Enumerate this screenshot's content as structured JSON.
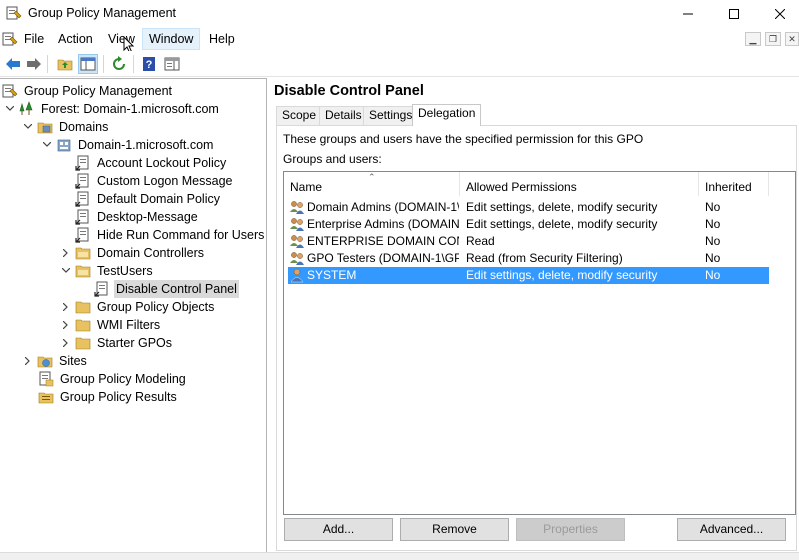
{
  "window": {
    "title": "Group Policy Management"
  },
  "menu": {
    "items": [
      "File",
      "Action",
      "View",
      "Window",
      "Help"
    ]
  },
  "tree": {
    "items": [
      {
        "label": "Group Policy Management",
        "icon": "gpm-icon"
      },
      {
        "label": "Forest: Domain-1.microsoft.com",
        "icon": "forest-icon"
      },
      {
        "label": "Domains",
        "icon": "domains-folder-icon"
      },
      {
        "label": "Domain-1.microsoft.com",
        "icon": "domain-icon"
      },
      {
        "label": "Account Lockout Policy",
        "icon": "gpo-link-icon"
      },
      {
        "label": "Custom Logon Message",
        "icon": "gpo-link-icon"
      },
      {
        "label": "Default Domain Policy",
        "icon": "gpo-link-icon"
      },
      {
        "label": "Desktop-Message",
        "icon": "gpo-link-icon"
      },
      {
        "label": "Hide Run Command for Users",
        "icon": "gpo-link-icon"
      },
      {
        "label": "Domain Controllers",
        "icon": "ou-folder-icon"
      },
      {
        "label": "TestUsers",
        "icon": "ou-folder-icon"
      },
      {
        "label": "Disable Control Panel",
        "icon": "gpo-link-icon"
      },
      {
        "label": "Group Policy Objects",
        "icon": "folder-icon"
      },
      {
        "label": "WMI Filters",
        "icon": "folder-icon"
      },
      {
        "label": "Starter GPOs",
        "icon": "folder-icon"
      },
      {
        "label": "Sites",
        "icon": "sites-icon"
      },
      {
        "label": "Group Policy Modeling",
        "icon": "modeling-icon"
      },
      {
        "label": "Group Policy Results",
        "icon": "results-icon"
      }
    ]
  },
  "details": {
    "title": "Disable Control Panel",
    "tabs": [
      "Scope",
      "Details",
      "Settings",
      "Delegation"
    ],
    "active_tab": "Delegation",
    "description": "These groups and users have the specified permission for this GPO",
    "groups_label": "Groups and users:",
    "columns": [
      "Name",
      "Allowed Permissions",
      "Inherited"
    ],
    "rows": [
      {
        "name": "Domain Admins (DOMAIN-1\\...",
        "perm": "Edit settings, delete, modify security",
        "inherited": "No"
      },
      {
        "name": "Enterprise Admins (DOMAIN-...",
        "perm": "Edit settings, delete, modify security",
        "inherited": "No"
      },
      {
        "name": "ENTERPRISE DOMAIN CON...",
        "perm": "Read",
        "inherited": "No"
      },
      {
        "name": "GPO Testers (DOMAIN-1\\GP...",
        "perm": "Read (from Security Filtering)",
        "inherited": "No"
      },
      {
        "name": "SYSTEM",
        "perm": "Edit settings, delete, modify security",
        "inherited": "No"
      }
    ],
    "selected_row": 4,
    "buttons": {
      "add": "Add...",
      "remove": "Remove",
      "properties": "Properties",
      "advanced": "Advanced..."
    }
  },
  "colors": {
    "selection": "#3399ff",
    "menu_active": "#e5f1fb"
  }
}
